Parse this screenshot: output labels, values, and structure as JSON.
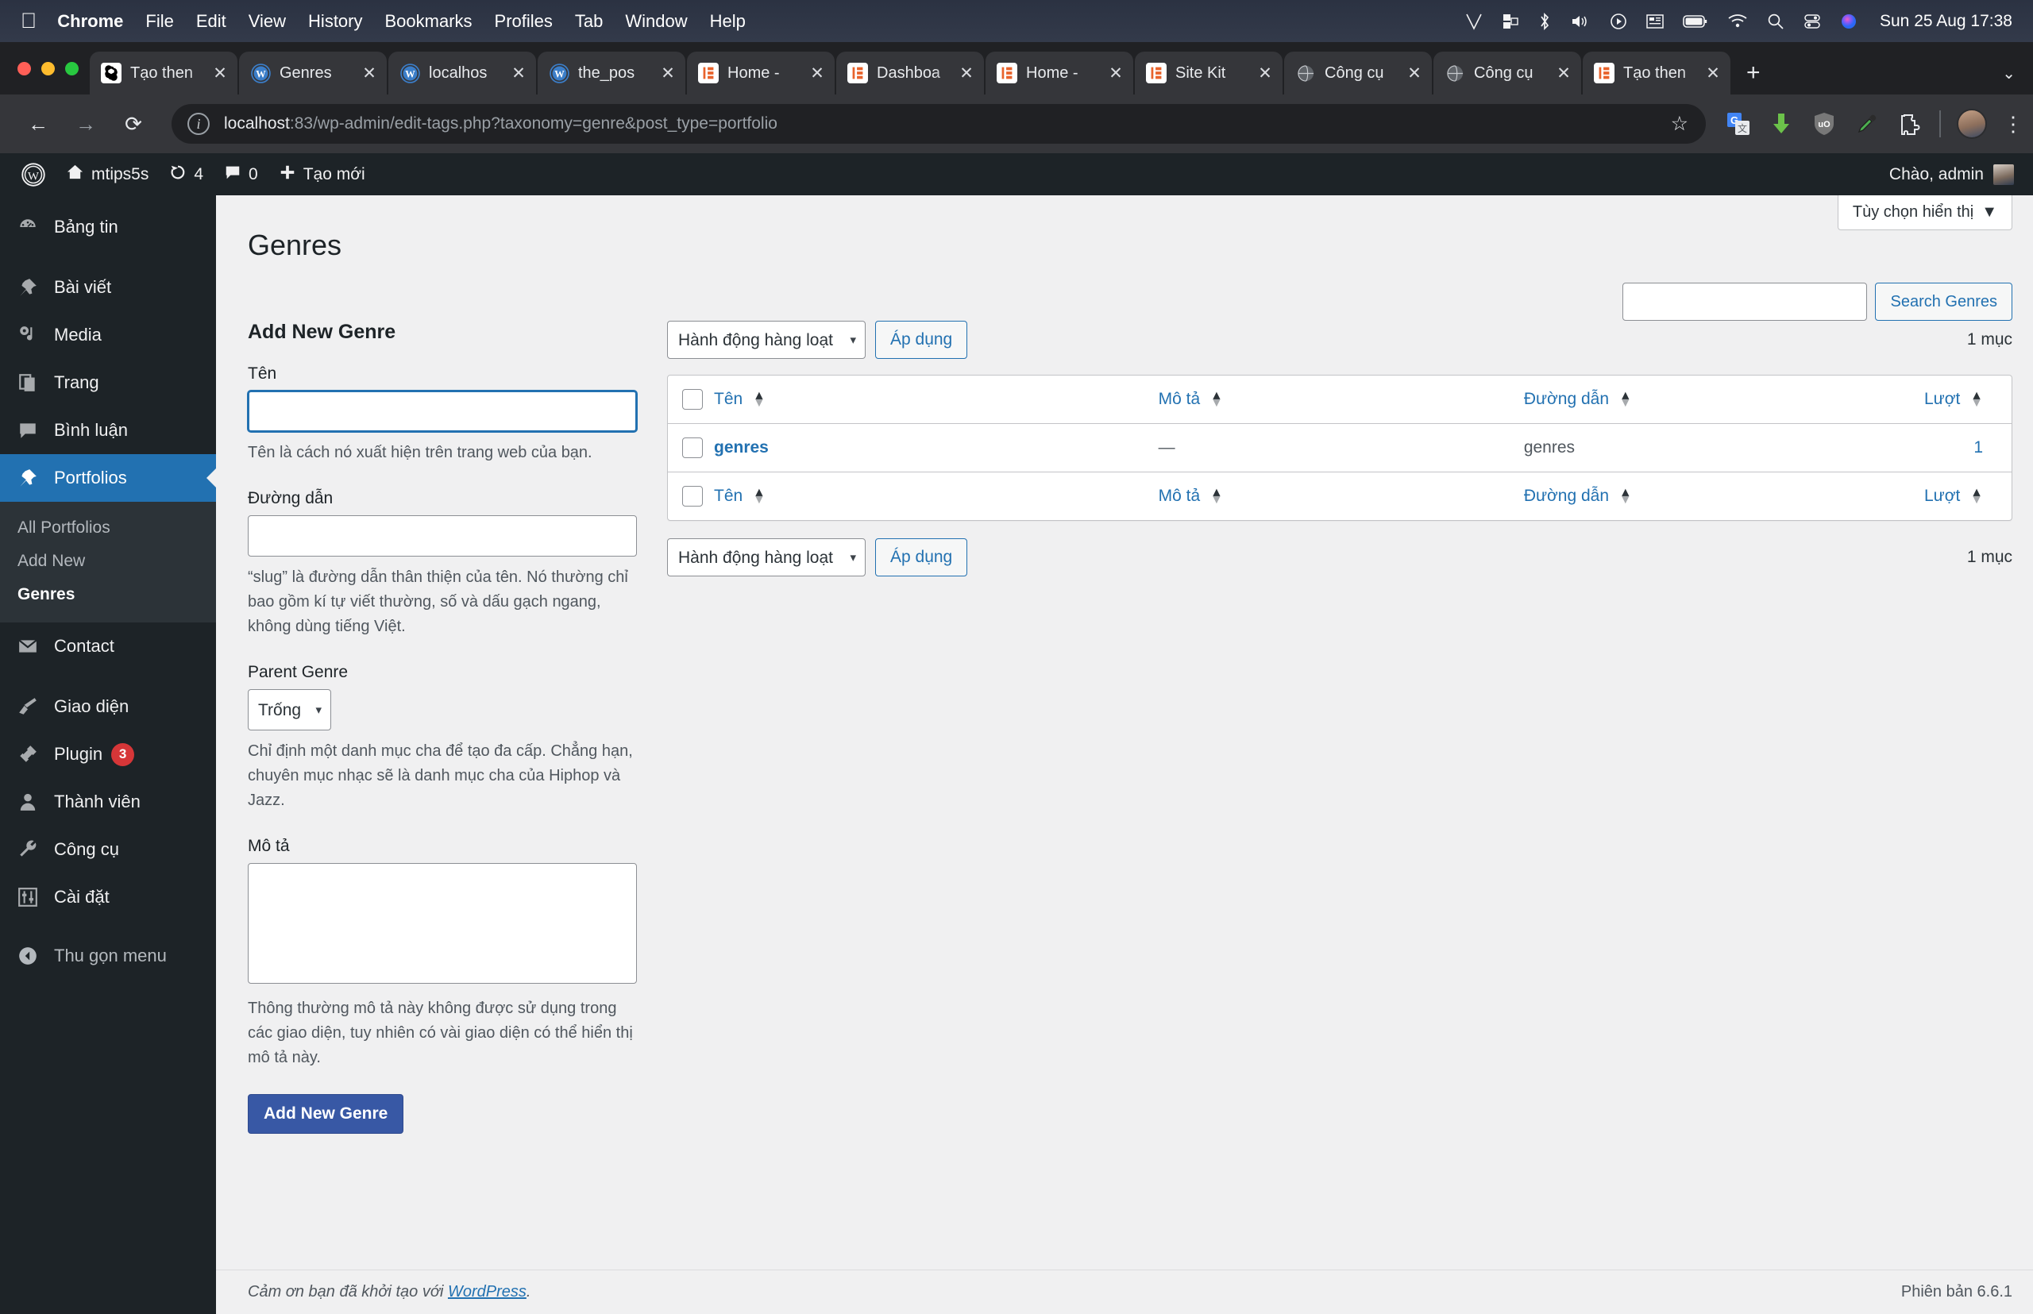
{
  "macos_menubar": {
    "apple_logo": "apple-icon",
    "items": [
      "Chrome",
      "File",
      "Edit",
      "View",
      "History",
      "Bookmarks",
      "Profiles",
      "Tab",
      "Window",
      "Help"
    ],
    "status_icons": [
      "vpn-v-icon",
      "display-arrange-icon",
      "bluetooth-icon",
      "volume-icon",
      "play-circle-icon",
      "news-icon",
      "battery-icon",
      "wifi-icon",
      "search-icon",
      "control-center-icon",
      "siri-icon"
    ],
    "clock": "Sun 25 Aug  17:38"
  },
  "browser": {
    "tabs": [
      {
        "label": "Tạo then",
        "favicon": "openai-icon"
      },
      {
        "label": "Genres ",
        "favicon": "wordpress-icon",
        "active": true
      },
      {
        "label": "localhos",
        "favicon": "wordpress-icon"
      },
      {
        "label": "the_pos",
        "favicon": "wordpress-icon"
      },
      {
        "label": "Home -",
        "favicon": "elementor-icon"
      },
      {
        "label": "Dashboa",
        "favicon": "elementor-icon"
      },
      {
        "label": "Home -",
        "favicon": "elementor-icon"
      },
      {
        "label": "Site Kit",
        "favicon": "elementor-icon"
      },
      {
        "label": "Công cụ",
        "favicon": "globe-icon"
      },
      {
        "label": "Công cụ",
        "favicon": "globe-icon"
      },
      {
        "label": "Tạo then",
        "favicon": "elementor-icon"
      }
    ],
    "new_tab_label": "+",
    "tab_list_chevron": "⌄",
    "close_glyph": "✕",
    "nav": {
      "back": "←",
      "forward": "→",
      "reload": "⟳"
    },
    "omnibox": {
      "info_icon": "site-info-icon",
      "url_host": "localhost",
      "url_path": ":83/wp-admin/edit-tags.php?taxonomy=genre&post_type=portfolio",
      "bookmark_icon": "star-icon"
    },
    "toolbar_icons": [
      "google-translate-icon",
      "download-icon",
      "ublock-origin-icon",
      "eyedropper-icon",
      "extensions-icon"
    ],
    "profile_avatar": "avatar",
    "menu_icon": "kebab-menu-icon"
  },
  "wp_adminbar": {
    "logo": "wordpress-logo-icon",
    "site_name": "mtips5s",
    "site_icon": "home-icon",
    "updates_icon": "updates-icon",
    "updates_count": "4",
    "comments_icon": "comment-icon",
    "comments_count": "0",
    "new_icon": "plus-icon",
    "new_label": "Tạo mới",
    "greeting": "Chào, admin"
  },
  "sidebar": {
    "items": [
      {
        "label": "Bảng tin",
        "icon": "dashboard-icon"
      },
      {
        "label": "Bài viết",
        "icon": "pin-icon"
      },
      {
        "label": "Media",
        "icon": "media-icon"
      },
      {
        "label": "Trang",
        "icon": "pages-icon"
      },
      {
        "label": "Bình luận",
        "icon": "comment-icon"
      },
      {
        "label": "Portfolios",
        "icon": "pin-icon",
        "current": true
      },
      {
        "label": "Contact",
        "icon": "envelope-icon"
      },
      {
        "label": "Giao diện",
        "icon": "appearance-brush-icon"
      },
      {
        "label": "Plugin",
        "icon": "plugin-icon",
        "badge": "3"
      },
      {
        "label": "Thành viên",
        "icon": "users-icon"
      },
      {
        "label": "Công cụ",
        "icon": "tools-wrench-icon"
      },
      {
        "label": "Cài đặt",
        "icon": "settings-sliders-icon"
      }
    ],
    "submenu": [
      {
        "label": "All Portfolios"
      },
      {
        "label": "Add New"
      },
      {
        "label": "Genres",
        "current": true
      }
    ],
    "collapse": {
      "label": "Thu gọn menu",
      "icon": "collapse-arrow-icon"
    }
  },
  "screen_options": {
    "label": "Tùy chọn hiển thị",
    "caret": "▼"
  },
  "page": {
    "title": "Genres"
  },
  "search": {
    "value": "",
    "placeholder": "",
    "button_label": "Search Genres"
  },
  "form": {
    "heading": "Add New Genre",
    "name": {
      "label": "Tên",
      "value": "",
      "help": "Tên là cách nó xuất hiện trên trang web của bạn."
    },
    "slug": {
      "label": "Đường dẫn",
      "value": "",
      "help": "“slug” là đường dẫn thân thiện của tên. Nó thường chỉ bao gồm kí tự viết thường, số và dấu gạch ngang, không dùng tiếng Việt."
    },
    "parent": {
      "label": "Parent Genre",
      "selected": "Trống",
      "options": [
        "Trống"
      ],
      "help": "Chỉ định một danh mục cha để tạo đa cấp. Chẳng hạn, chuyên mục nhạc sẽ là danh mục cha của Hiphop và Jazz."
    },
    "description": {
      "label": "Mô tả",
      "value": "",
      "help": "Thông thường mô tả này không được sử dụng trong các giao diện, tuy nhiên có vài giao diện có thể hiển thị mô tả này."
    },
    "submit_label": "Add New Genre"
  },
  "tablenav": {
    "bulk_selected": "Hành động hàng loạt",
    "bulk_options": [
      "Hành động hàng loạt"
    ],
    "apply_label": "Áp dụng",
    "count_top": "1 mục",
    "count_bottom": "1 mục"
  },
  "table": {
    "columns": [
      {
        "label": "Tên",
        "sortable": true
      },
      {
        "label": "Mô tả",
        "sortable": true
      },
      {
        "label": "Đường dẫn",
        "sortable": true
      },
      {
        "label": "Lượt",
        "sortable": true
      }
    ],
    "rows": [
      {
        "name": "genres",
        "description": "—",
        "slug": "genres",
        "count": "1"
      }
    ]
  },
  "footer": {
    "thanks_prefix": "Cảm ơn bạn đã khởi tạo với ",
    "thanks_link": "WordPress",
    "thanks_suffix": ".",
    "version": "Phiên bản 6.6.1"
  }
}
